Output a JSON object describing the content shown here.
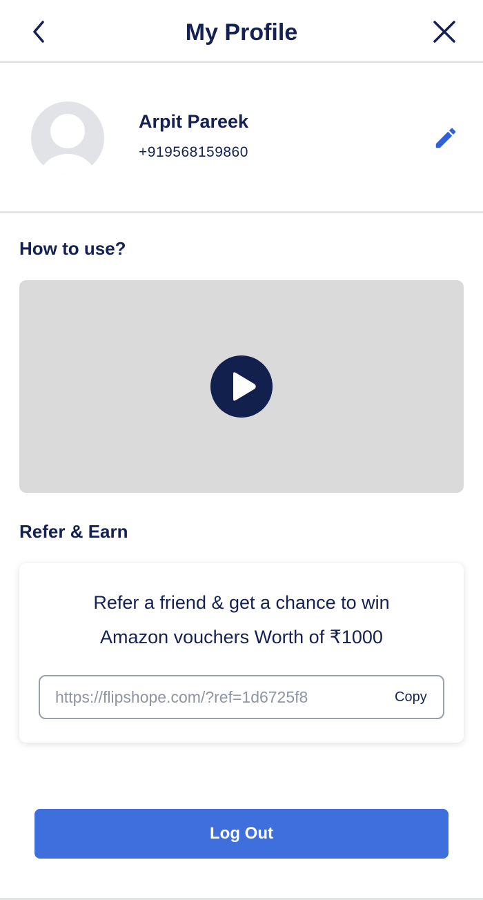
{
  "header": {
    "title": "My Profile",
    "back_icon": "chevron-left-icon",
    "close_icon": "close-icon"
  },
  "profile": {
    "name": "Arpit Pareek",
    "phone": "+919568159860",
    "avatar_icon": "user-avatar-icon",
    "edit_icon": "pencil-icon"
  },
  "how_to_use": {
    "title": "How to use?",
    "play_icon": "play-icon"
  },
  "refer": {
    "title": "Refer & Earn",
    "message_line1": "Refer a friend & get a chance to win",
    "message_line2": "Amazon vouchers Worth of ₹1000",
    "link_value": "https://flipshope.com/?ref=1d6725f8",
    "copy_label": "Copy"
  },
  "logout_label": "Log Out",
  "colors": {
    "primary_text": "#142152",
    "accent_blue": "#3e6fdd",
    "edit_icon": "#2f62d8",
    "play_button": "#12204d",
    "video_placeholder": "#dadada"
  }
}
